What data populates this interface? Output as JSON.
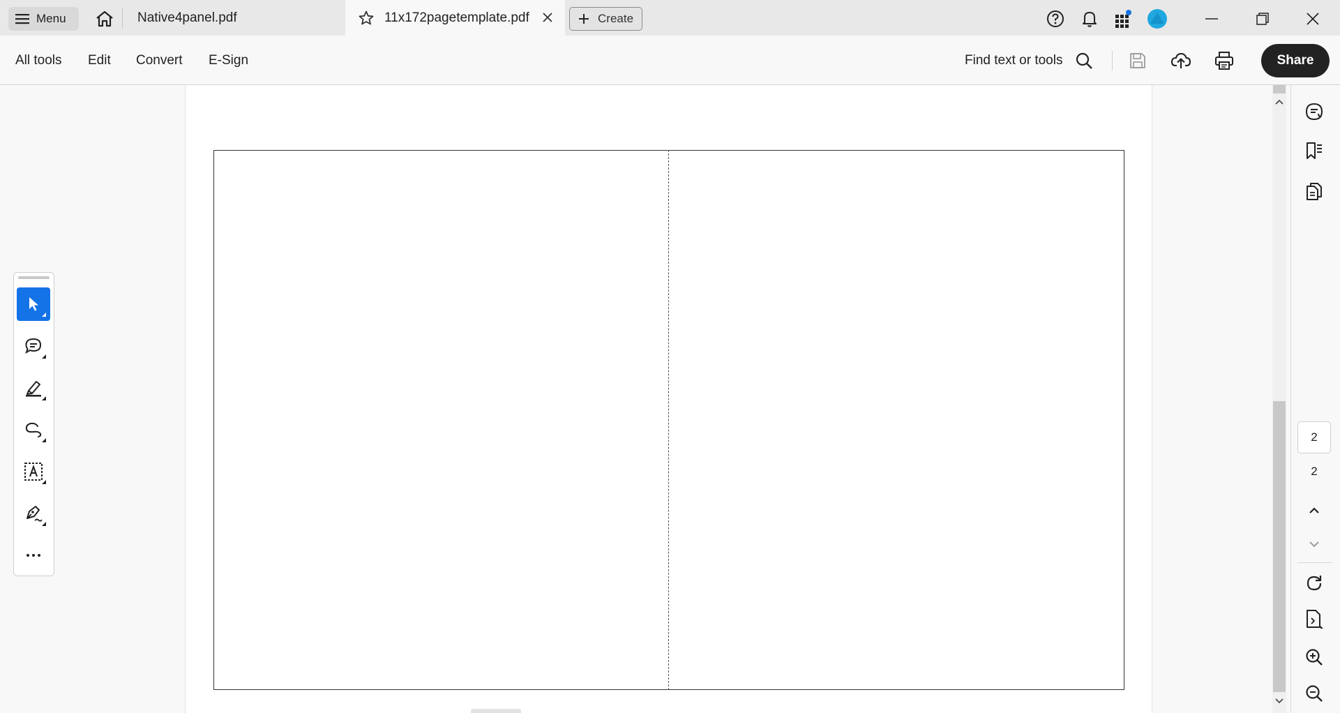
{
  "tabbar": {
    "menu_label": "Menu",
    "tabs": [
      {
        "label": "Native4panel.pdf",
        "active": false
      },
      {
        "label": "11x172pagetemplate.pdf",
        "active": true
      }
    ],
    "create_label": "Create"
  },
  "toolbar": {
    "nav": [
      "All tools",
      "Edit",
      "Convert",
      "E-Sign"
    ],
    "find_label": "Find text or tools",
    "share_label": "Share"
  },
  "page_nav": {
    "current_page": "2",
    "total_pages": "2"
  },
  "colors": {
    "accent": "#1473e6",
    "tabbar_bg": "#e8e8e8",
    "share_bg": "#222222",
    "profile_avatar": "#1fa7e0"
  },
  "icons": {
    "tabbar": [
      "hamburger-icon",
      "home-icon",
      "star-icon",
      "close-icon",
      "plus-icon",
      "help-icon",
      "bell-icon",
      "apps-grid-icon",
      "profile-avatar-icon",
      "minimize-icon",
      "restore-icon",
      "window-close-icon"
    ],
    "toolbar": [
      "search-icon",
      "save-icon",
      "cloud-upload-icon",
      "print-icon"
    ],
    "quick_tools": [
      "select-cursor-icon",
      "comment-icon",
      "highlighter-icon",
      "freehand-draw-icon",
      "text-box-icon",
      "sign-pen-icon",
      "more-icon"
    ],
    "right_rail": [
      "ai-assistant-icon",
      "bookmarks-icon",
      "copy-pages-icon",
      "page-up-icon",
      "page-down-icon",
      "rotate-icon",
      "page-thumbnail-icon",
      "zoom-in-icon",
      "zoom-out-icon"
    ]
  }
}
